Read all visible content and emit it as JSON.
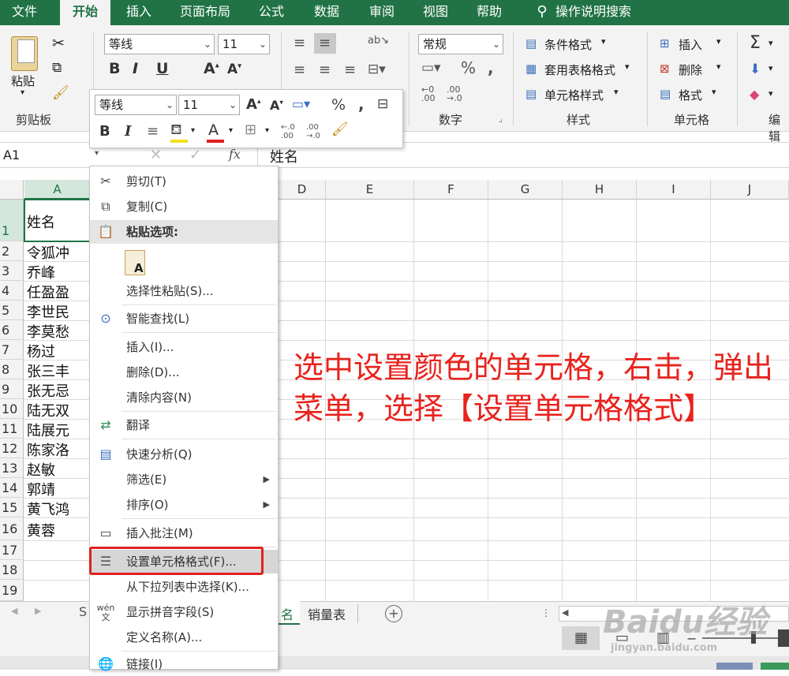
{
  "tabs": [
    "文件",
    "开始",
    "插入",
    "页面布局",
    "公式",
    "数据",
    "审阅",
    "视图",
    "帮助"
  ],
  "tell_me": "操作说明搜索",
  "ribbon": {
    "paste": "粘贴",
    "clipboard_group": "剪贴板",
    "font_name": "等线",
    "font_size": "11",
    "number_format": "常规",
    "number_group": "数字",
    "cond_format": "条件格式",
    "table_format": "套用表格格式",
    "cell_style": "单元格样式",
    "style_group": "样式",
    "insert": "插入",
    "delete": "删除",
    "format": "格式",
    "cells_group": "单元格",
    "edit_group": "编辑"
  },
  "mini_toolbar": {
    "font_name": "等线",
    "font_size": "11"
  },
  "formula_bar": {
    "name_box": "A1",
    "fx": "fx",
    "content": "姓名"
  },
  "columns": [
    "A",
    "B",
    "C",
    "D",
    "E",
    "F",
    "G",
    "H",
    "I",
    "J"
  ],
  "rows": [
    "1",
    "2",
    "3",
    "4",
    "5",
    "6",
    "7",
    "8",
    "9",
    "10",
    "11",
    "12",
    "13",
    "14",
    "15",
    "16",
    "17",
    "18",
    "19"
  ],
  "cells": [
    "姓名",
    "令狐冲",
    "乔峰",
    "任盈盈",
    "李世民",
    "李莫愁",
    "杨过",
    "张三丰",
    "张无忌",
    "陆无双",
    "陆展元",
    "陈家洛",
    "赵敏",
    "郭靖",
    "黄飞鸿",
    "黄蓉"
  ],
  "context_menu": {
    "cut": "剪切(T)",
    "copy": "复制(C)",
    "paste_options": "粘贴选项:",
    "paste_special": "选择性粘贴(S)...",
    "smart_lookup": "智能查找(L)",
    "insert": "插入(I)...",
    "delete": "删除(D)...",
    "clear": "清除内容(N)",
    "translate": "翻译",
    "quick_analysis": "快速分析(Q)",
    "filter": "筛选(E)",
    "sort": "排序(O)",
    "insert_comment": "插入批注(M)",
    "format_cells": "设置单元格格式(F)...",
    "pick_list": "从下拉列表中选择(K)...",
    "phonetic": "显示拼音字段(S)",
    "define_name": "定义名称(A)...",
    "link": "链接(I)"
  },
  "annotation": "选中设置颜色的单元格，右击，弹出菜单，选择【设置单元格格式】",
  "sheet_tabs": [
    "S",
    "名",
    "销量表"
  ],
  "watermark": "Baidu经验",
  "watermark_url": "jingyan.baidu.com",
  "colors": {
    "excel_green": "#217346",
    "annotation_red": "#e8221c",
    "highlight_box": "#e02020"
  }
}
